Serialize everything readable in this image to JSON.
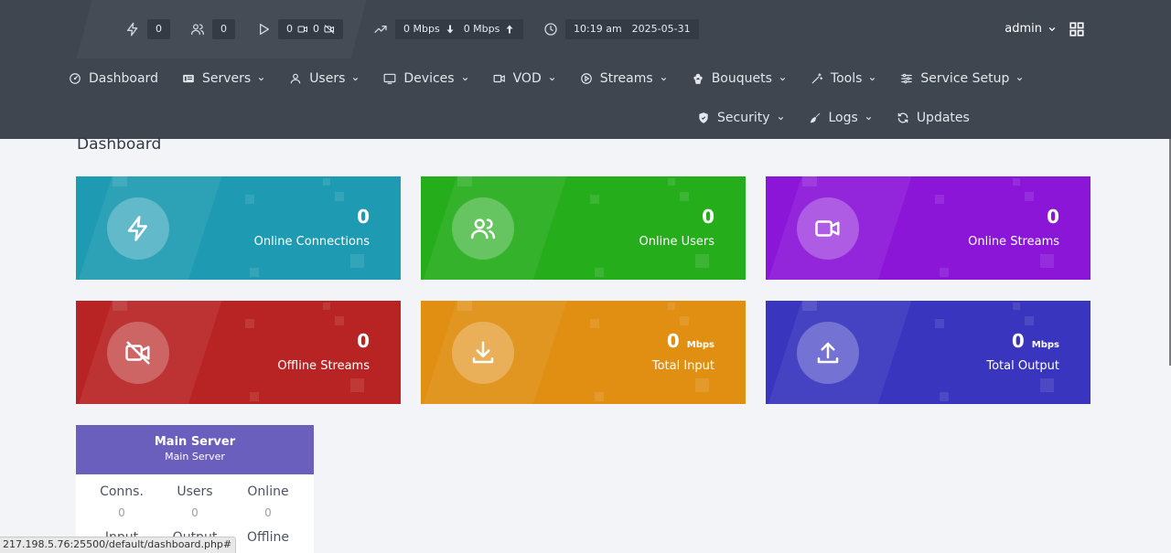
{
  "topbar": {
    "connections": "0",
    "users": "0",
    "streams_live": "0",
    "streams_video": "0",
    "bandwidth_in": "0 Mbps",
    "bandwidth_out": "0 Mbps",
    "time": "10:19 am",
    "date": "2025-05-31",
    "user": "admin"
  },
  "nav": {
    "row1": [
      {
        "label": "Dashboard",
        "icon": "dashboard-icon",
        "dropdown": false
      },
      {
        "label": "Servers",
        "icon": "server-icon",
        "dropdown": true
      },
      {
        "label": "Users",
        "icon": "user-icon",
        "dropdown": true
      },
      {
        "label": "Devices",
        "icon": "devices-icon",
        "dropdown": true
      },
      {
        "label": "VOD",
        "icon": "vod-icon",
        "dropdown": true
      },
      {
        "label": "Streams",
        "icon": "play-icon",
        "dropdown": true
      },
      {
        "label": "Bouquets",
        "icon": "bouquet-icon",
        "dropdown": true
      },
      {
        "label": "Tools",
        "icon": "magic-wand-icon",
        "dropdown": true
      },
      {
        "label": "Service Setup",
        "icon": "sliders-icon",
        "dropdown": true
      }
    ],
    "row2": [
      {
        "label": "Security",
        "icon": "shield-icon",
        "dropdown": true
      },
      {
        "label": "Logs",
        "icon": "broom-icon",
        "dropdown": true
      },
      {
        "label": "Updates",
        "icon": "sync-icon",
        "dropdown": false
      }
    ]
  },
  "page": {
    "title": "Dashboard"
  },
  "cards": [
    {
      "label": "Online Connections",
      "value": "0",
      "unit": "",
      "color": "#1e9bb2",
      "icon": "lightning-icon"
    },
    {
      "label": "Online Users",
      "value": "0",
      "unit": "",
      "color": "#25ad1c",
      "icon": "users-icon"
    },
    {
      "label": "Online Streams",
      "value": "0",
      "unit": "",
      "color": "#8b16d8",
      "icon": "video-camera-icon"
    },
    {
      "label": "Offline Streams",
      "value": "0",
      "unit": "",
      "color": "#b82323",
      "icon": "video-off-icon"
    },
    {
      "label": "Total Input",
      "value": "0",
      "unit": "Mbps",
      "color": "#e08f12",
      "icon": "download-icon"
    },
    {
      "label": "Total Output",
      "value": "0",
      "unit": "Mbps",
      "color": "#3935bf",
      "icon": "upload-icon"
    }
  ],
  "server": {
    "title": "Main Server",
    "subtitle": "Main Server",
    "cols": [
      {
        "label": "Conns.",
        "value": "0"
      },
      {
        "label": "Users",
        "value": "0"
      },
      {
        "label": "Online",
        "value": "0"
      }
    ],
    "row2": [
      "Input",
      "Output",
      "Offline"
    ],
    "header_color": "#6b5fbd"
  },
  "status_url": "217.198.5.76:25500/default/dashboard.php#"
}
